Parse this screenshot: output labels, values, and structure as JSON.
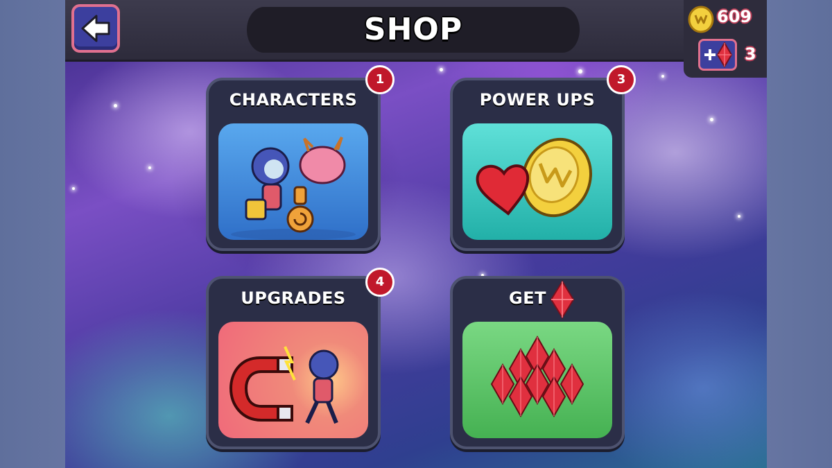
{
  "header": {
    "title": "SHOP"
  },
  "currency": {
    "coins": "609",
    "gems": "3"
  },
  "cards": [
    {
      "label": "CHARACTERS",
      "badge": "1"
    },
    {
      "label": "POWER UPS",
      "badge": "3"
    },
    {
      "label": "UPGRADES",
      "badge": "4"
    },
    {
      "label": "GET",
      "badge": ""
    }
  ],
  "icons": {
    "back": "back-arrow-icon",
    "coin": "coin-icon",
    "gem": "red-gem-icon",
    "plus": "plus-icon",
    "heart": "heart-icon",
    "magnet": "magnet-icon"
  },
  "colors": {
    "button_blue": "#3c3f9e",
    "button_border": "#e0708f",
    "badge_red": "#c0182b",
    "card_bg": "#2b2e47",
    "characters_art": "#3f8fe0",
    "powerups_art": "#38c9c0",
    "upgrades_art": "#f07a86",
    "gems_art": "#5ec46a"
  }
}
